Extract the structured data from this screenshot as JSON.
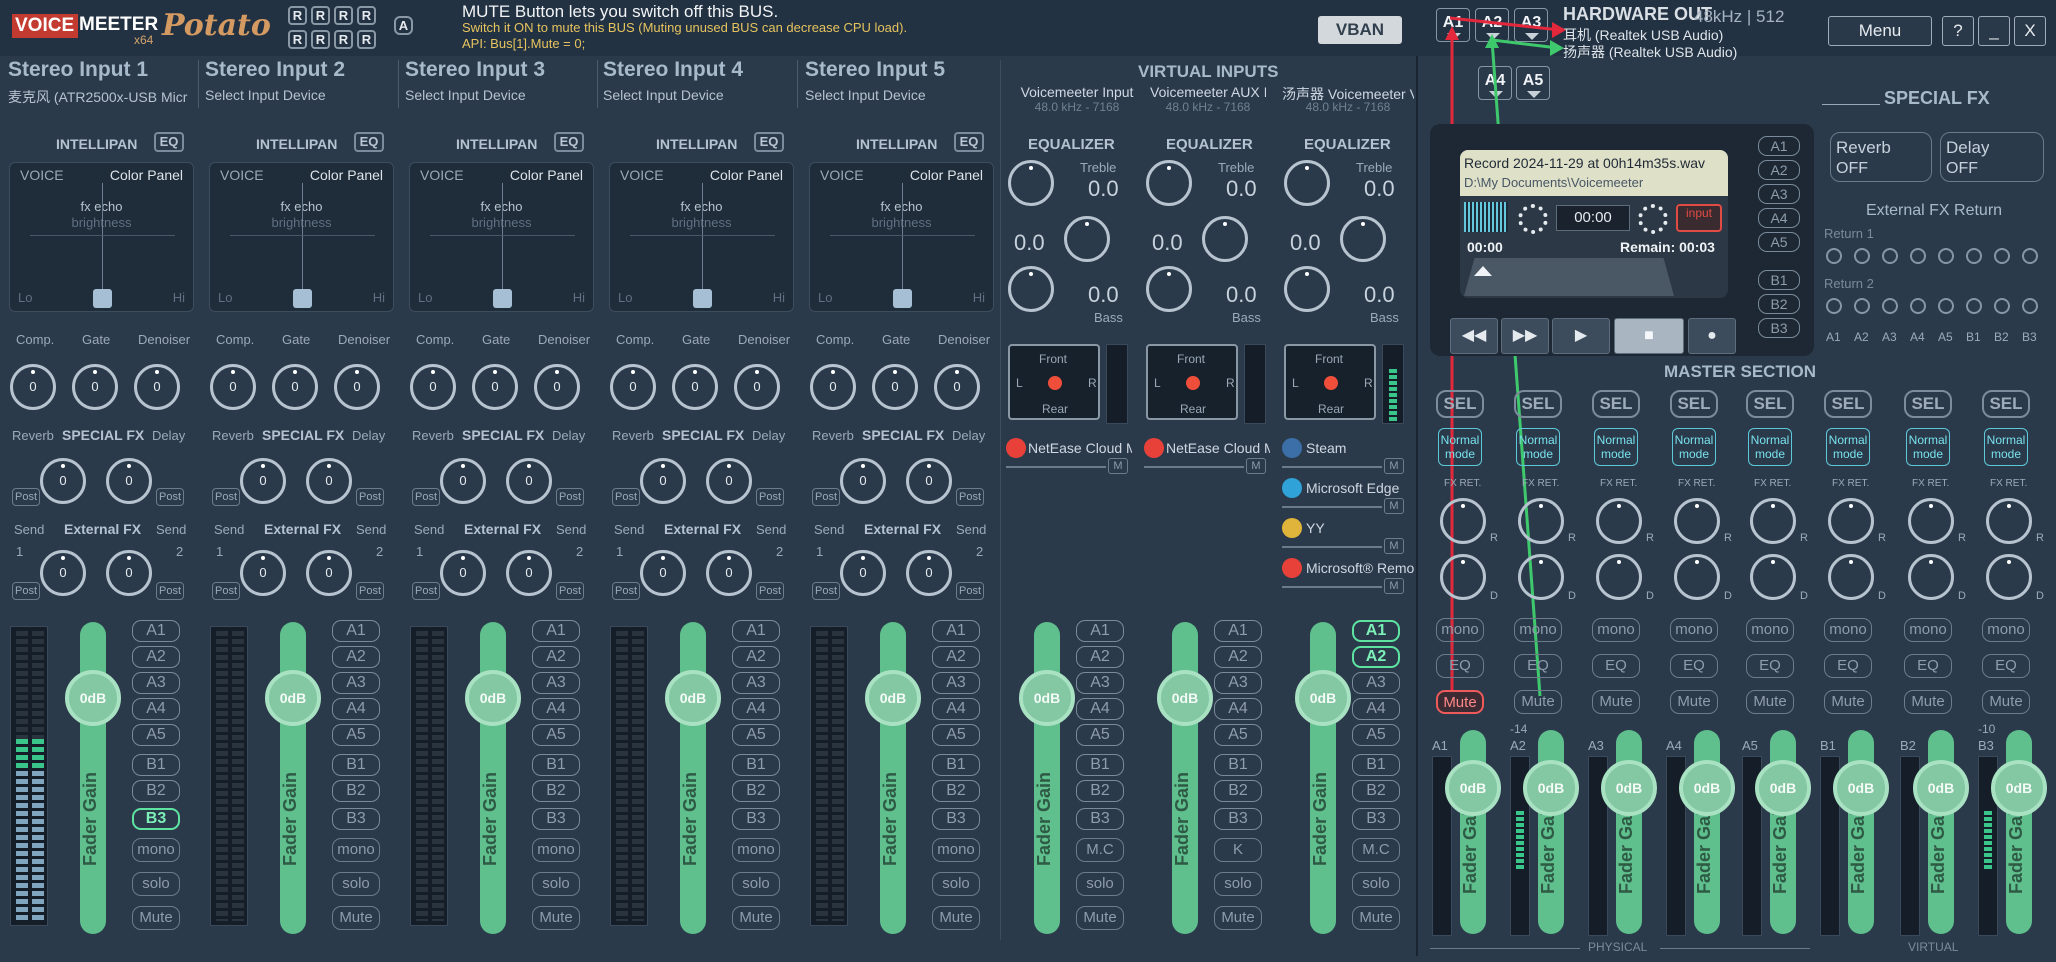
{
  "app": {
    "logo_voice": "VOICE",
    "logo_meeter": "MEETER",
    "logo_x64": "x64",
    "logo_potato": "Potato",
    "r": "R"
  },
  "tooltip": {
    "line1": "MUTE Button lets you switch off this BUS.",
    "line2": "Switch it ON to mute this BUS (Muting unused BUS can decrease CPU load).",
    "line3": "API: Bus[1].Mute = 0;"
  },
  "vban": "VBAN",
  "hw": {
    "title": "HARDWARE OUT",
    "rate": "48kHz | 512",
    "dev1": "耳机 (Realtek USB Audio)",
    "dev2": "扬声器 (Realtek USB Audio)",
    "buttons": [
      "A1",
      "A2",
      "A3",
      "A4",
      "A5"
    ]
  },
  "window": {
    "menu": "Menu",
    "help": "?",
    "min": "_",
    "close": "X"
  },
  "inputs": [
    {
      "name": "Stereo Input 1",
      "device": "麦克风 (ATR2500x-USB Micro"
    },
    {
      "name": "Stereo Input 2",
      "device": "Select Input Device"
    },
    {
      "name": "Stereo Input 3",
      "device": "Select Input Device"
    },
    {
      "name": "Stereo Input 4",
      "device": "Select Input Device"
    },
    {
      "name": "Stereo Input 5",
      "device": "Select Input Device"
    }
  ],
  "virtual": {
    "title": "VIRTUAL INPUTS",
    "strips": [
      {
        "name": "Voicemeeter Input",
        "info": "48.0 kHz - 7168",
        "app1": "NetEase Cloud M"
      },
      {
        "name": "Voicemeeter AUX I",
        "info": "48.0 kHz - 7168",
        "app1": "NetEase Cloud M"
      },
      {
        "name": "汤声器 Voicemeeter V",
        "info": "48.0 kHz - 7168",
        "apps": [
          "Steam",
          "Microsoft Edge",
          "YY",
          "Microsoft® Remo"
        ]
      }
    ]
  },
  "labels": {
    "intellipan": "INTELLIPAN",
    "eq": "EQ",
    "voice": "VOICE",
    "color_panel": "Color Panel",
    "fx_echo": "fx echo",
    "brightness": "brightness",
    "lo": "Lo",
    "hi": "Hi",
    "comp": "Comp.",
    "gate": "Gate",
    "denoiser": "Denoiser",
    "reverb": "Reverb",
    "special_fx": "SPECIAL FX",
    "delay": "Delay",
    "send": "Send",
    "external_fx": "External FX",
    "post": "Post",
    "one": "1",
    "two": "2",
    "zero": "0",
    "fader_gain": "Fader Gain",
    "odb": "0dB",
    "mono": "mono",
    "solo": "solo",
    "mute": "Mute",
    "mc": "M.C",
    "k": "K",
    "equalizer": "EQUALIZER",
    "treble": "Treble",
    "bass": "Bass",
    "eqval": "0.0",
    "front": "Front",
    "rear": "Rear",
    "l": "L",
    "r": "R",
    "m": "M"
  },
  "buses": [
    "A1",
    "A2",
    "A3",
    "A4",
    "A5",
    "B1",
    "B2",
    "B3"
  ],
  "tape": {
    "file": "Record 2024-11-29 at 00h14m35s.wav",
    "path": "D:\\My Documents\\Voicemeeter",
    "time": "00:00",
    "elapsed": "00:00",
    "remain": "Remain: 00:03",
    "input": "input"
  },
  "special_fx": {
    "title": "SPECIAL FX",
    "reverb": "Reverb",
    "reverb_state": "OFF",
    "delay": "Delay",
    "delay_state": "OFF",
    "ext_return": "External FX Return",
    "return1": "Return 1",
    "return2": "Return 2"
  },
  "master": {
    "title": "MASTER SECTION",
    "sel": "SEL",
    "normal": "Normal mode",
    "fxret": "FX RET.",
    "d": "D",
    "r": "R",
    "physical": "PHYSICAL",
    "virtual": "VIRTUAL",
    "strips": [
      "A1",
      "A2",
      "A3",
      "A4",
      "A5",
      "B1",
      "B2",
      "B3"
    ],
    "a2_level": "-14",
    "b3_level": "-10"
  }
}
